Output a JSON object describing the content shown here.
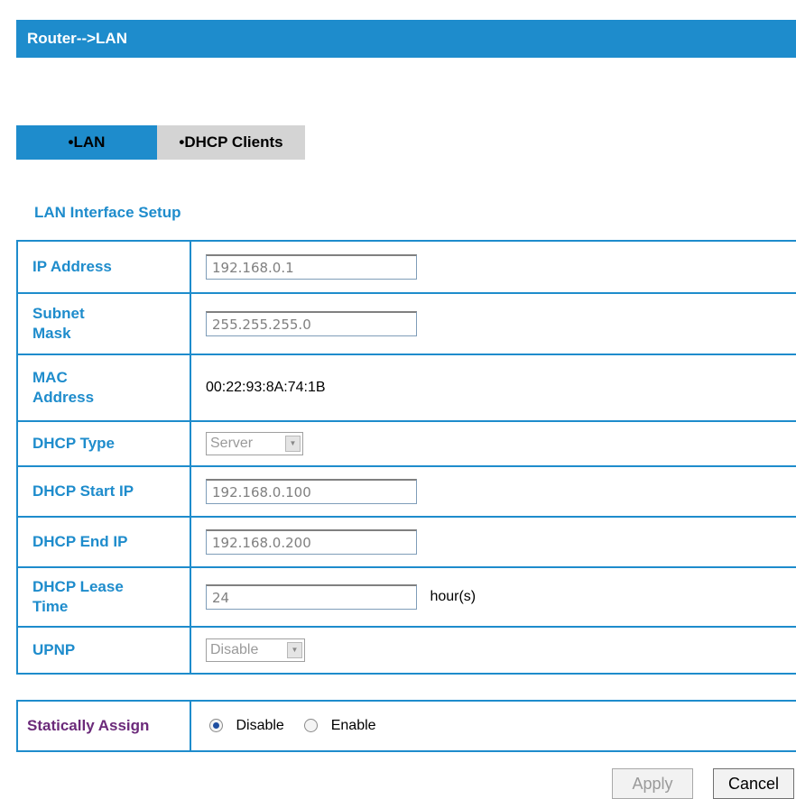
{
  "header": {
    "title": "Router-->LAN"
  },
  "tabs": [
    {
      "label": "•LAN",
      "active": true
    },
    {
      "label": "•DHCP Clients",
      "active": false
    }
  ],
  "section_title": "LAN Interface Setup",
  "fields": {
    "ip_address": {
      "label": "IP Address",
      "value": "192.168.0.1"
    },
    "subnet_mask": {
      "label": "Subnet Mask",
      "value": "255.255.255.0"
    },
    "mac_address": {
      "label": "MAC Address",
      "value": "00:22:93:8A:74:1B"
    },
    "dhcp_type": {
      "label": "DHCP Type",
      "value": "Server"
    },
    "dhcp_start_ip": {
      "label": "DHCP Start IP",
      "value": "192.168.0.100"
    },
    "dhcp_end_ip": {
      "label": "DHCP End IP",
      "value": "192.168.0.200"
    },
    "dhcp_lease_time": {
      "label": "DHCP Lease Time",
      "value": "24",
      "unit": "hour(s)"
    },
    "upnp": {
      "label": "UPNP",
      "value": "Disable"
    }
  },
  "static_assign": {
    "label": "Statically Assign",
    "options": [
      "Disable",
      "Enable"
    ],
    "selected": "Disable"
  },
  "buttons": {
    "apply": "Apply",
    "cancel": "Cancel"
  },
  "colors": {
    "accent": "#1e8ccc",
    "tab_inactive": "#d4d4d4",
    "static_label": "#6b2a7a"
  }
}
